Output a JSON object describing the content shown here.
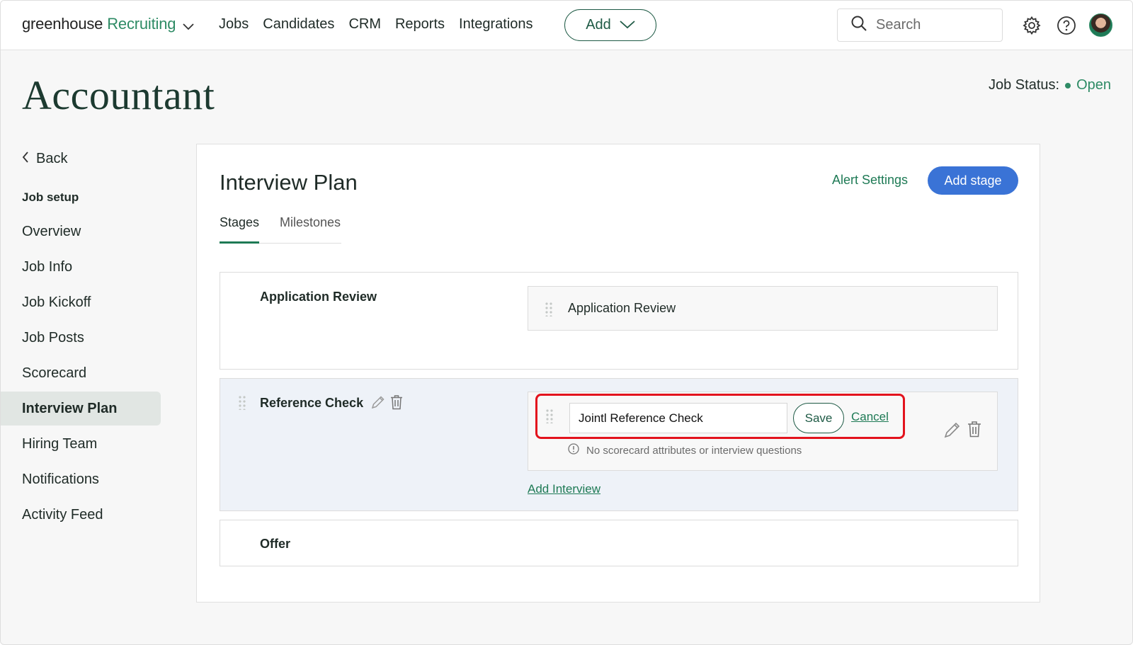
{
  "brand": {
    "part1": "greenhouse",
    "part2": "Recruiting"
  },
  "nav": {
    "items": [
      "Jobs",
      "Candidates",
      "CRM",
      "Reports",
      "Integrations"
    ],
    "add_label": "Add"
  },
  "search": {
    "placeholder": "Search"
  },
  "page": {
    "title": "Accountant",
    "job_status_label": "Job Status:",
    "job_status_value": "Open"
  },
  "sidebar": {
    "back_label": "Back",
    "section_label": "Job setup",
    "items": [
      "Overview",
      "Job Info",
      "Job Kickoff",
      "Job Posts",
      "Scorecard",
      "Interview Plan",
      "Hiring Team",
      "Notifications",
      "Activity Feed"
    ],
    "active": "Interview Plan"
  },
  "panel": {
    "title": "Interview Plan",
    "alert_settings": "Alert Settings",
    "add_stage": "Add stage",
    "tabs": [
      "Stages",
      "Milestones"
    ]
  },
  "stages": {
    "application_review": {
      "name": "Application Review",
      "interview": "Application Review"
    },
    "reference_check": {
      "name": "Reference Check",
      "edit_value": "Jointl Reference Check",
      "save_label": "Save",
      "cancel_label": "Cancel",
      "hint": "No scorecard attributes or interview questions",
      "add_interview": "Add Interview"
    },
    "offer": {
      "name": "Offer"
    }
  },
  "colors": {
    "accent_green": "#2e8b65",
    "primary_blue": "#3a73d6",
    "highlight_red": "#e3131d"
  }
}
